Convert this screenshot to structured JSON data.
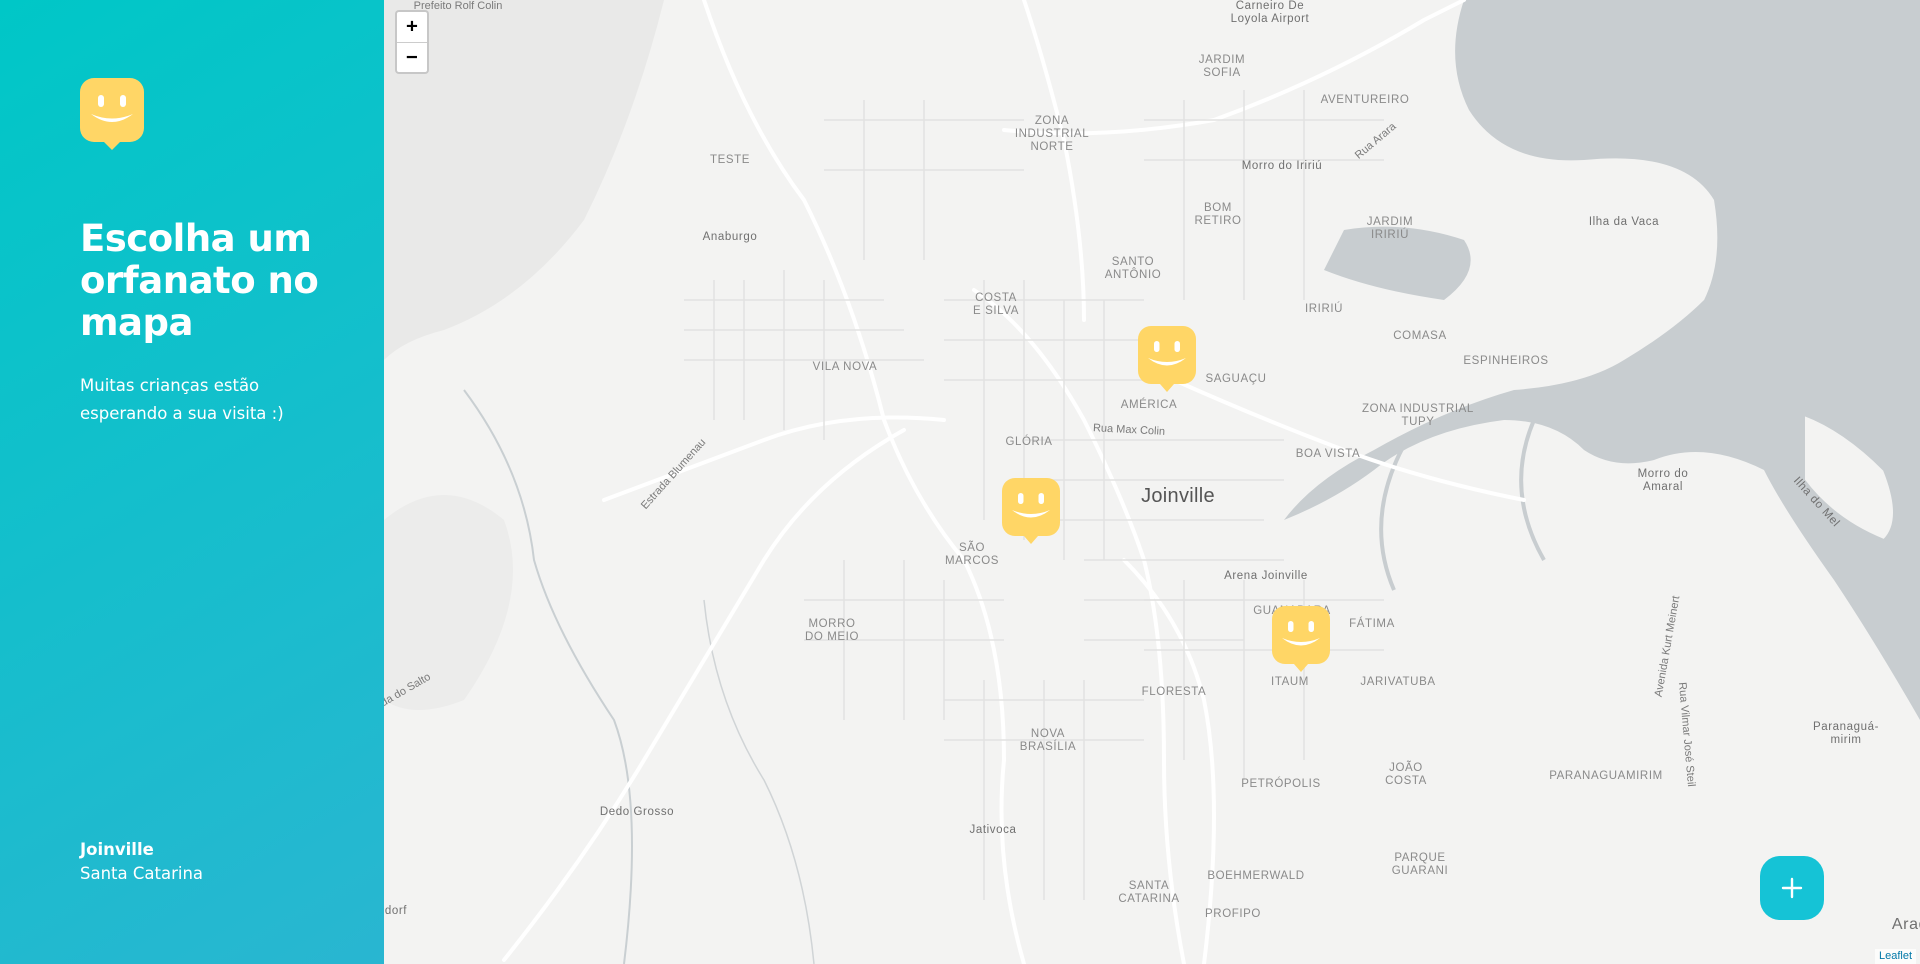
{
  "sidebar": {
    "title": "Escolha um orfanato no mapa",
    "subtitle": "Muitas crianças estão esperando a sua visita :)",
    "location": {
      "city": "Joinville",
      "state": "Santa Catarina"
    }
  },
  "map": {
    "zoom_in": "+",
    "zoom_out": "−",
    "attribution": "Leaflet",
    "labels": [
      {
        "id": "prefeito",
        "text": "Prefeito Rolf Colin",
        "cls": "street"
      },
      {
        "id": "airport",
        "text": "Carneiro De\nLoyola Airport",
        "cls": "dark"
      },
      {
        "id": "jardim-sofia",
        "text": "JARDIM\nSOFIA",
        "cls": ""
      },
      {
        "id": "aventureiro",
        "text": "AVENTUREIRO",
        "cls": ""
      },
      {
        "id": "zona-norte",
        "text": "ZONA\nINDUSTRIAL\nNORTE",
        "cls": ""
      },
      {
        "id": "rua-arara",
        "text": "Rua Arara",
        "cls": "street"
      },
      {
        "id": "teste",
        "text": "TESTE",
        "cls": ""
      },
      {
        "id": "morro-iririu",
        "text": "Morro do Iririú",
        "cls": "dark"
      },
      {
        "id": "bom-retiro",
        "text": "BOM\nRETIRO",
        "cls": ""
      },
      {
        "id": "jardim-iririu",
        "text": "JARDIM\nIRIRIÚ",
        "cls": ""
      },
      {
        "id": "ilha-vaca",
        "text": "Ilha da Vaca",
        "cls": "dark"
      },
      {
        "id": "anaburgo",
        "text": "Anaburgo",
        "cls": "dark"
      },
      {
        "id": "santo-antonio",
        "text": "SANTO\nANTÔNIO",
        "cls": ""
      },
      {
        "id": "costa-silva",
        "text": "COSTA\nE SILVA",
        "cls": ""
      },
      {
        "id": "iririu",
        "text": "IRIRIÚ",
        "cls": ""
      },
      {
        "id": "comasa",
        "text": "COMASA",
        "cls": ""
      },
      {
        "id": "espinheiros",
        "text": "ESPINHEIROS",
        "cls": ""
      },
      {
        "id": "vila-nova",
        "text": "VILA NOVA",
        "cls": ""
      },
      {
        "id": "saguacu",
        "text": "SAGUAÇU",
        "cls": ""
      },
      {
        "id": "america",
        "text": "AMÉRICA",
        "cls": ""
      },
      {
        "id": "zona-tupy",
        "text": "ZONA INDUSTRIAL\nTUPY",
        "cls": ""
      },
      {
        "id": "rua-max",
        "text": "Rua Max Colin",
        "cls": "street"
      },
      {
        "id": "gloria",
        "text": "GLÓRIA",
        "cls": ""
      },
      {
        "id": "morro-amaral",
        "text": "Morro do\nAmaral",
        "cls": "dark"
      },
      {
        "id": "estrada-blumenau",
        "text": "Estrada Blumenau",
        "cls": "street"
      },
      {
        "id": "boa-vista",
        "text": "BOA VISTA",
        "cls": ""
      },
      {
        "id": "joinville",
        "text": "Joinville",
        "cls": "city"
      },
      {
        "id": "ilha-mel",
        "text": "Ilha do Mel",
        "cls": "dark"
      },
      {
        "id": "sao-marcos",
        "text": "SÃO\nMARCOS",
        "cls": ""
      },
      {
        "id": "arena",
        "text": "Arena Joinville",
        "cls": "dark"
      },
      {
        "id": "guanabara",
        "text": "GUANABARA",
        "cls": ""
      },
      {
        "id": "fatima",
        "text": "FÁTIMA",
        "cls": ""
      },
      {
        "id": "morro-meio",
        "text": "MORRO\nDO MEIO",
        "cls": ""
      },
      {
        "id": "av-meinert",
        "text": "Avenida Kurt Meinert",
        "cls": "street"
      },
      {
        "id": "estrada-salto",
        "text": "da do Salto",
        "cls": "street"
      },
      {
        "id": "itaum",
        "text": "ITAUM",
        "cls": ""
      },
      {
        "id": "jarivatuba",
        "text": "JARIVATUBA",
        "cls": ""
      },
      {
        "id": "floresta",
        "text": "FLORESTA",
        "cls": ""
      },
      {
        "id": "rua-steil",
        "text": "Rua Vilmar José Steil",
        "cls": "street"
      },
      {
        "id": "paranagua-mirim",
        "text": "Paranaguá-\nmirim",
        "cls": "dark"
      },
      {
        "id": "nova-brasilia",
        "text": "NOVA\nBRASÍLIA",
        "cls": ""
      },
      {
        "id": "joao-costa",
        "text": "JOÃO\nCOSTA",
        "cls": ""
      },
      {
        "id": "paranaguamirim",
        "text": "PARANAGUAMIRIM",
        "cls": ""
      },
      {
        "id": "petropolis",
        "text": "PETRÓPOLIS",
        "cls": ""
      },
      {
        "id": "dedo-grosso",
        "text": "Dedo Grosso",
        "cls": "dark"
      },
      {
        "id": "jativoca",
        "text": "Jativoca",
        "cls": "dark"
      },
      {
        "id": "parque-guarani",
        "text": "PARQUE\nGUARANI",
        "cls": ""
      },
      {
        "id": "boehmerwald",
        "text": "BOEHMERWALD",
        "cls": ""
      },
      {
        "id": "santa-catarina",
        "text": "SANTA\nCATARINA",
        "cls": ""
      },
      {
        "id": "dorf",
        "text": "dorf",
        "cls": "dark"
      },
      {
        "id": "profipo",
        "text": "PROFIPO",
        "cls": ""
      },
      {
        "id": "araq",
        "text": "Araq",
        "cls": "dark"
      }
    ],
    "marker_count": 3
  },
  "colors": {
    "sidebar_start": "#00c7c7",
    "sidebar_end": "#29b6d1",
    "marker": "#ffd666",
    "add_button": "#15c3d6",
    "water": "#c8cdd0"
  },
  "icons": {
    "logo": "smile-logo-icon",
    "marker": "orphanage-marker-icon",
    "add": "plus-icon"
  }
}
